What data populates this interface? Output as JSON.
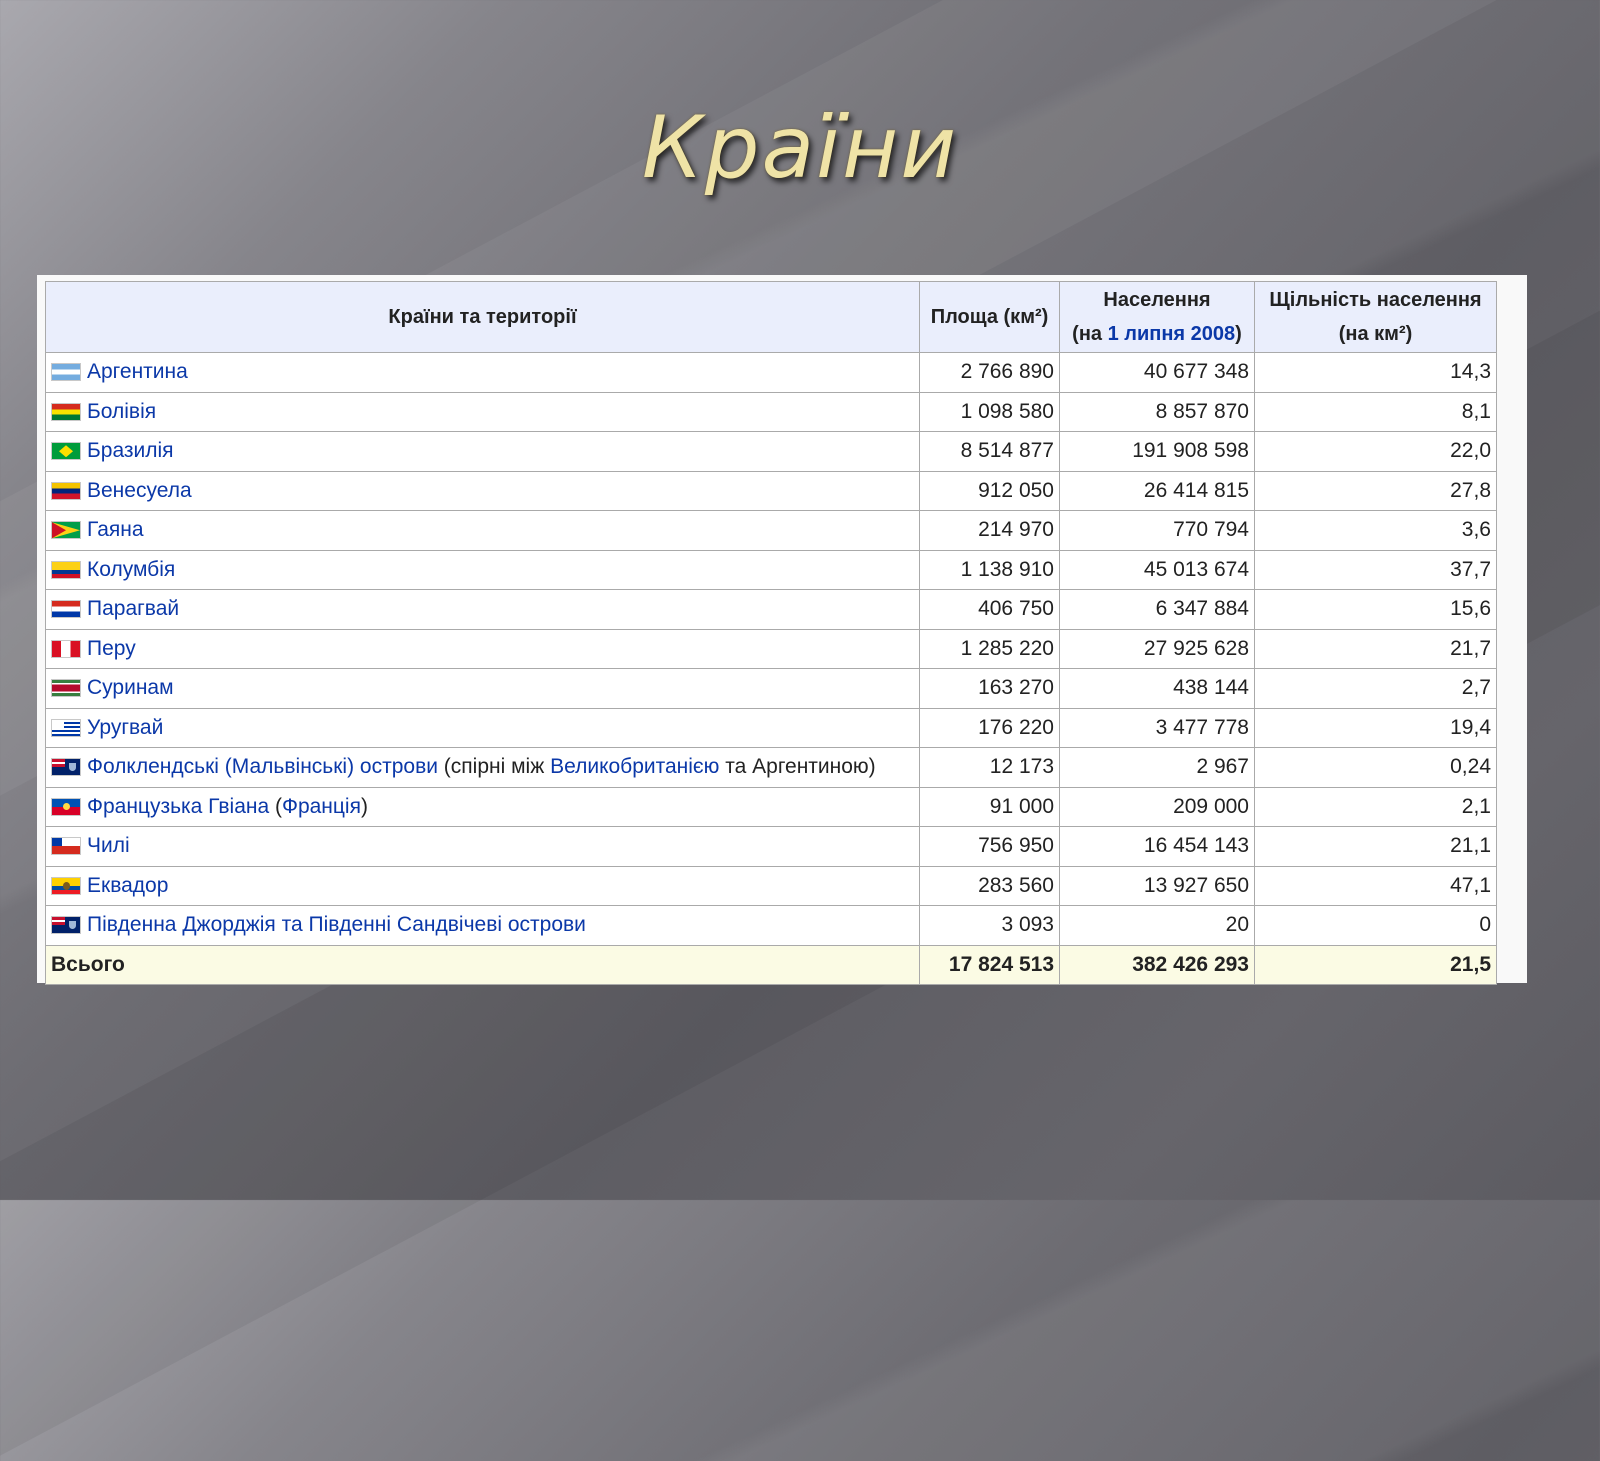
{
  "slide": {
    "title": "Країни"
  },
  "table": {
    "headers": {
      "country": "Країни та території",
      "area": "Площа (км²)",
      "population_line1": "Населення",
      "population_line2_open": "(на ",
      "population_line2_link": "1 липня 2008",
      "population_line2_close": ")",
      "density_line1": "Щільність населення",
      "density_line2": "(на км²)"
    },
    "rows": [
      {
        "flag": "argentina-flag-icon",
        "parts": [
          {
            "text": "Аргентина",
            "link": true
          }
        ],
        "area": "2 766 890",
        "population": "40 677 348",
        "density": "14,3"
      },
      {
        "flag": "bolivia-flag-icon",
        "parts": [
          {
            "text": "Болівія",
            "link": true
          }
        ],
        "area": "1 098 580",
        "population": "8 857 870",
        "density": "8,1"
      },
      {
        "flag": "brazil-flag-icon",
        "parts": [
          {
            "text": "Бразилія",
            "link": true
          }
        ],
        "area": "8 514 877",
        "population": "191 908 598",
        "density": "22,0"
      },
      {
        "flag": "venezuela-flag-icon",
        "parts": [
          {
            "text": "Венесуела",
            "link": true
          }
        ],
        "area": "912 050",
        "population": "26 414 815",
        "density": "27,8"
      },
      {
        "flag": "guyana-flag-icon",
        "parts": [
          {
            "text": "Гаяна",
            "link": true
          }
        ],
        "area": "214 970",
        "population": "770 794",
        "density": "3,6"
      },
      {
        "flag": "colombia-flag-icon",
        "parts": [
          {
            "text": "Колумбія",
            "link": true
          }
        ],
        "area": "1 138 910",
        "population": "45 013 674",
        "density": "37,7"
      },
      {
        "flag": "paraguay-flag-icon",
        "parts": [
          {
            "text": "Парагвай",
            "link": true
          }
        ],
        "area": "406 750",
        "population": "6 347 884",
        "density": "15,6"
      },
      {
        "flag": "peru-flag-icon",
        "parts": [
          {
            "text": "Перу",
            "link": true
          }
        ],
        "area": "1 285 220",
        "population": "27 925 628",
        "density": "21,7"
      },
      {
        "flag": "suriname-flag-icon",
        "parts": [
          {
            "text": "Суринам",
            "link": true
          }
        ],
        "area": "163 270",
        "population": "438 144",
        "density": "2,7"
      },
      {
        "flag": "uruguay-flag-icon",
        "parts": [
          {
            "text": "Уругвай",
            "link": true
          }
        ],
        "area": "176 220",
        "population": "3 477 778",
        "density": "19,4"
      },
      {
        "flag": "falklands-flag-icon",
        "parts": [
          {
            "text": "Фолклендські (Мальвінські) острови",
            "link": true
          },
          {
            "text": " (спірні між ",
            "link": false
          },
          {
            "text": "Великобританією",
            "link": true
          },
          {
            "text": " та Аргентиною)",
            "link": false
          }
        ],
        "area": "12 173",
        "population": "2 967",
        "density": "0,24"
      },
      {
        "flag": "french-guiana-flag-icon",
        "parts": [
          {
            "text": "Французька Гвіана",
            "link": true
          },
          {
            "text": " (",
            "link": false
          },
          {
            "text": "Франція",
            "link": true
          },
          {
            "text": ")",
            "link": false
          }
        ],
        "area": "91 000",
        "population": "209 000",
        "density": "2,1"
      },
      {
        "flag": "chile-flag-icon",
        "parts": [
          {
            "text": "Чилі",
            "link": true
          }
        ],
        "area": "756 950",
        "population": "16 454 143",
        "density": "21,1"
      },
      {
        "flag": "ecuador-flag-icon",
        "parts": [
          {
            "text": "Еквадор",
            "link": true
          }
        ],
        "area": "283 560",
        "population": "13 927 650",
        "density": "47,1"
      },
      {
        "flag": "south-georgia-flag-icon",
        "parts": [
          {
            "text": "Південна Джорджія та Південні Сандвічеві острови",
            "link": true
          }
        ],
        "area": "3 093",
        "population": "20",
        "density": "0"
      }
    ],
    "total": {
      "label": "Всього",
      "area": "17 824 513",
      "population": "382 426 293",
      "density": "21,5"
    }
  }
}
